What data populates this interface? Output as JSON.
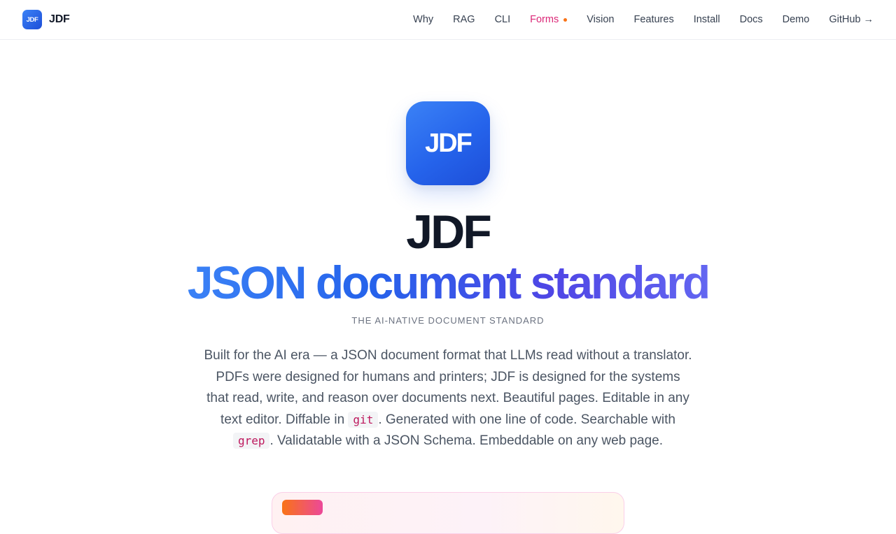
{
  "brand": {
    "logo_text": "JDF",
    "name": "JDF"
  },
  "nav": {
    "items": [
      {
        "label": "Why"
      },
      {
        "label": "RAG"
      },
      {
        "label": "CLI"
      },
      {
        "label": "Forms",
        "active": true,
        "badge_dot": true
      },
      {
        "label": "Vision"
      },
      {
        "label": "Features"
      },
      {
        "label": "Install"
      },
      {
        "label": "Docs"
      },
      {
        "label": "Demo"
      },
      {
        "label": "GitHub →"
      }
    ]
  },
  "hero": {
    "icon_text": "JDF",
    "title": "JDF",
    "subtitle": "JSON document standard",
    "kicker": "THE AI-NATIVE DOCUMENT STANDARD",
    "lede": {
      "part1": "Built for the AI era — a JSON document format that LLMs read without a translator. PDFs were designed for humans and printers; JDF is designed for the systems that read, write, and reason over documents next. Beautiful pages. Editable in any text editor. Diffable in ",
      "code1": "git",
      "part2": ". Generated with one line of code. Searchable with ",
      "code2": "grep",
      "part3": ". Validatable with a JSON Schema. Embeddable on any web page."
    }
  },
  "colors": {
    "accent": "#2563eb",
    "active_nav": "#db2777",
    "nav_dot": "#f97316",
    "gradient_start": "#3b82f6",
    "gradient_end": "#6366f1"
  }
}
